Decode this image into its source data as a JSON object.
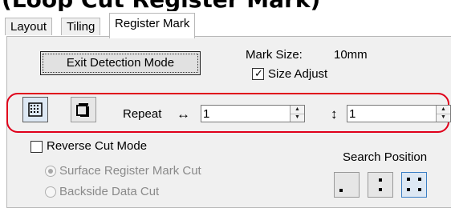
{
  "heading_text": "(Loop Cut Register Mark)",
  "tabs": [
    {
      "label": "Layout"
    },
    {
      "label": "Tiling"
    },
    {
      "label": "Register Mark"
    }
  ],
  "exit_button_label": "Exit Detection Mode",
  "mark_size": {
    "label": "Mark Size:",
    "value": "10mm"
  },
  "size_adjust": {
    "label": "Size Adjust",
    "checked": true
  },
  "repeat": {
    "label": "Repeat",
    "horizontal_symbol": "↔",
    "horizontal_value": "1",
    "vertical_symbol": "↕",
    "vertical_value": "1"
  },
  "reverse_cut_mode": {
    "label": "Reverse Cut Mode",
    "checked": false
  },
  "cut_options": [
    {
      "label": "Surface Register Mark Cut",
      "selected": true
    },
    {
      "label": "Backside Data Cut",
      "selected": false
    }
  ],
  "search_position": {
    "label": "Search Position"
  },
  "colors": {
    "highlight": "#e0001b",
    "selected_button_bg": "#dde8f4",
    "selected_button_border": "#3c7fc4"
  },
  "icons": {
    "mark_pattern_a": "grid-dots-icon",
    "mark_pattern_b": "stacked-corners-icon",
    "search_single": "single-dot-icon",
    "search_double": "two-dots-icon",
    "search_quad": "four-dots-icon"
  }
}
